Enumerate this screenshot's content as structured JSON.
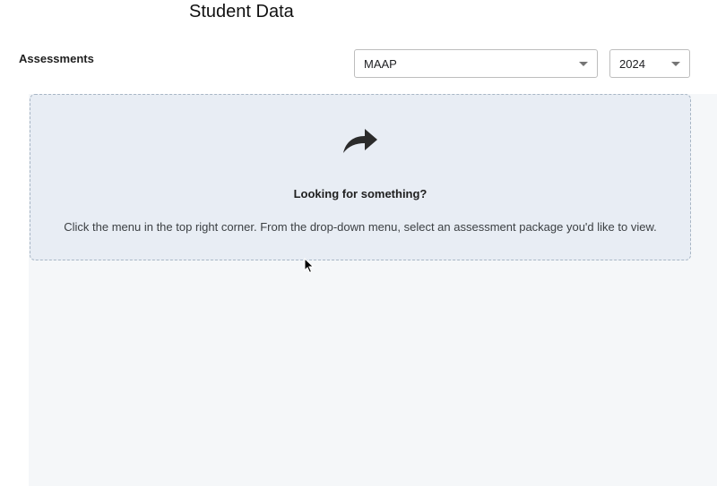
{
  "header": {
    "title": "Student Data"
  },
  "filters": {
    "section_label": "Assessments",
    "assessment_select": {
      "value": "MAAP"
    },
    "year_select": {
      "value": "2024"
    }
  },
  "empty_state": {
    "icon": "share-arrow-icon",
    "title": "Looking for something?",
    "message": "Click the menu in the top right corner. From the drop-down menu, select an assessment package you'd like to view."
  },
  "colors": {
    "panel_bg": "#e8edf4",
    "panel_border": "#a9b7c6",
    "content_bg": "#f5f7f9"
  }
}
